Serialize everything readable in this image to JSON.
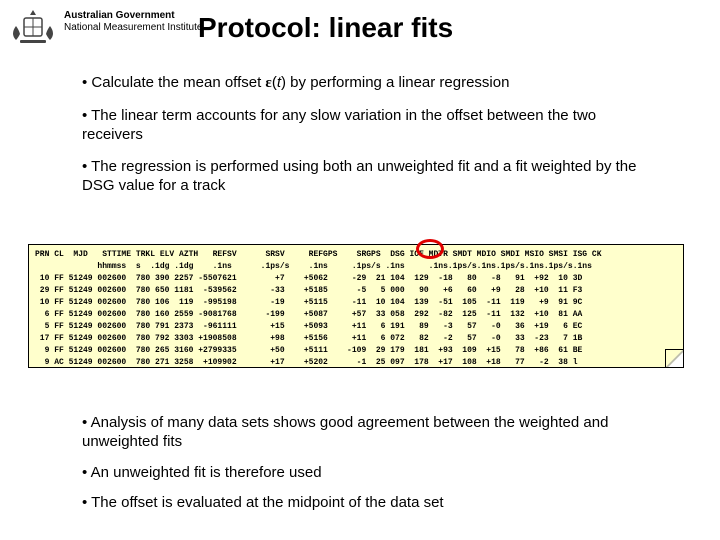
{
  "header": {
    "gov_line1": "Australian Government",
    "gov_line2": "National Measurement Institute",
    "title": "Protocol: linear fits"
  },
  "bullets_top": {
    "b1_pre": "• Calculate the mean offset ",
    "b1_eps": "ε",
    "b1_paren_open": "(",
    "b1_t": "t",
    "b1_paren_close": ") by performing a linear regression",
    "b2": "• The linear term accounts for any slow variation in the offset between the two receivers",
    "b3": "• The regression is performed using both an unweighted fit and a fit weighted by the DSG value for a track"
  },
  "data_table": {
    "lines": [
      "PRN CL  MJD   STTIME TRKL ELV AZTH   REFSV      SRSV     REFGPS    SRGPS  DSG IOE MDTR SMDT MDIO SMDI MSIO SMSI ISG CK",
      "             hhmmss  s  .1dg .1dg    .1ns      .1ps/s    .1ns     .1ps/s .1ns     .1ns.1ps/s.1ns.1ps/s.1ns.1ps/s.1ns",
      " 10 FF 51249 002600  780 390 2257 -5507621        +7    +5062     -29  21 104  129  -18   80   -8   91  +92  10 3D",
      " 29 FF 51249 002600  780 650 1181  -539562       -33    +5185      -5   5 000   90   +6   60   +9   28  +10  11 F3",
      " 10 FF 51249 002600  780 106  119  -995198       -19    +5115     -11  10 104  139  -51  105  -11  119   +9  91 9C",
      "  6 FF 51249 002600  780 160 2559 -9081768      -199    +5087     +57  33 058  292  -82  125  -11  132  +10  81 AA",
      "  5 FF 51249 002600  780 791 2373  -961111       +15    +5093     +11   6 191   89   -3   57   -0   36  +19   6 EC",
      " 17 FF 51249 002600  780 792 3303 +1908508       +98    +5156     +11   6 072   82   -2   57   -0   33  -23   7 1B",
      "  9 FF 51249 002600  780 265 3160 +2799335       +50    +5111    -109  29 179  181  +93  109  +15   78  +86  61 BE",
      "  9 AC 51249 002600  780 271 3258  +109902       +17    +5202      -1  25 097  178  +17  108  +18   77   -2  38 l"
    ]
  },
  "bullets_bottom": {
    "b4": "• Analysis of many data sets shows good agreement between the weighted and unweighted fits",
    "b5": "• An unweighted fit is therefore used",
    "b6": "• The offset is evaluated at the midpoint of the data set"
  }
}
